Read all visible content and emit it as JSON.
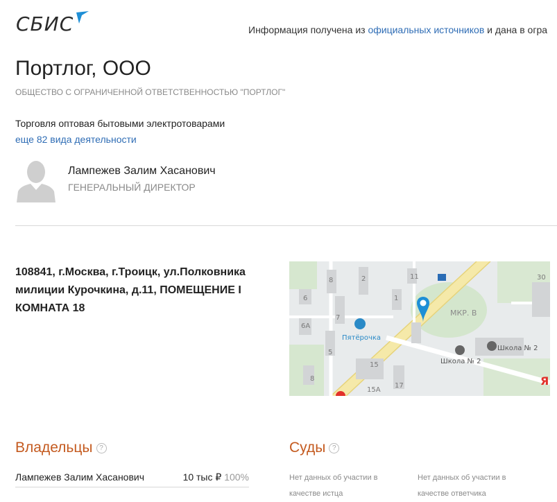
{
  "header": {
    "logo_text": "СБИС",
    "info_prefix": "Информация получена из ",
    "info_link": "официальных источников",
    "info_suffix": " и дана в огра"
  },
  "company": {
    "name": "Портлог, ООО",
    "full_name": "ОБЩЕСТВО С ОГРАНИЧЕННОЙ ОТВЕТСТВЕННОСТЬЮ \"ПОРТЛОГ\"",
    "activity": "Торговля оптовая бытовыми электротоварами",
    "more_activities": "еще 82 вида деятельности"
  },
  "director": {
    "name": "Лампежев Залим Хасанович",
    "role": "ГЕНЕРАЛЬНЫЙ ДИРЕКТОР"
  },
  "address": "108841, г.Москва, г.Троицк, ул.Полковника милиции Курочкина, д.11, ПОМЕЩЕНИЕ I КОМНАТА 18",
  "map": {
    "labels": {
      "b8": "8",
      "b2": "2",
      "b11": "11",
      "b30": "30",
      "b6": "6",
      "b1": "1",
      "b7": "7",
      "b6a": "6А",
      "b5": "5",
      "b15": "15",
      "b15a": "15А",
      "b8b": "8",
      "b17": "17",
      "mkr": "МКР. В",
      "pyat": "Пятёрочка",
      "school1": "Школа № 2",
      "school2": "Школа № 2",
      "yandex": "Я"
    }
  },
  "owners": {
    "title": "Владельцы",
    "items": [
      {
        "name": "Лампежев Залим Хасанович",
        "amount": "10 тыс ₽",
        "share": "100%"
      }
    ]
  },
  "courts": {
    "title": "Суды",
    "plaintiff": "Нет данных об участии в качестве истца",
    "defendant": "Нет данных об участии в качестве ответчика"
  },
  "colors": {
    "accent_orange": "#c45a1f",
    "link_blue": "#2f6db5",
    "logo_bird": "#1e8fd6"
  }
}
